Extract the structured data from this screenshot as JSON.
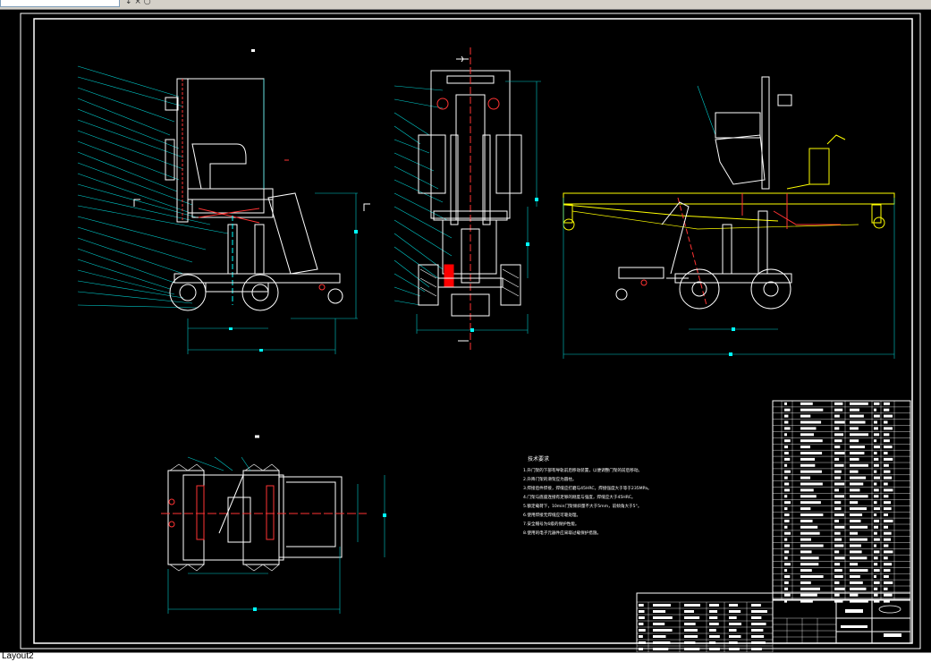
{
  "window": {
    "top_strip": {
      "icons": "↓ × ○"
    },
    "layout_tab": "Layout2"
  },
  "colors": {
    "background": "#000000",
    "outline": "#ffffff",
    "dimension": "#00ffff",
    "centerline": "#ff0000",
    "highlight": "#ffff00",
    "frame": "#ffffff"
  },
  "drawing": {
    "tech_requirements": {
      "title": "技术要求",
      "items": [
        "1.升门架的下部有导轨前后移动装置，以便调整门架的前后移动。",
        "2.升降门架的滑架应为圆柱。",
        "3.焊接后件焊接，焊缝应打磨与45HRC，焊接强度大于等于235MPa。",
        "4.门架与底座连接有足够的刚度与强度，焊缝应大于45HRC。",
        "5.额定载荷下，10min门架倾斜量不大于5mm，前倾角大于5°。",
        "6.使用焊接无焊缝应可靠处理。",
        "7.安全帽号为6级的保护性能。",
        "8.使用的电子元器件应采取过载保护措施。"
      ]
    }
  }
}
